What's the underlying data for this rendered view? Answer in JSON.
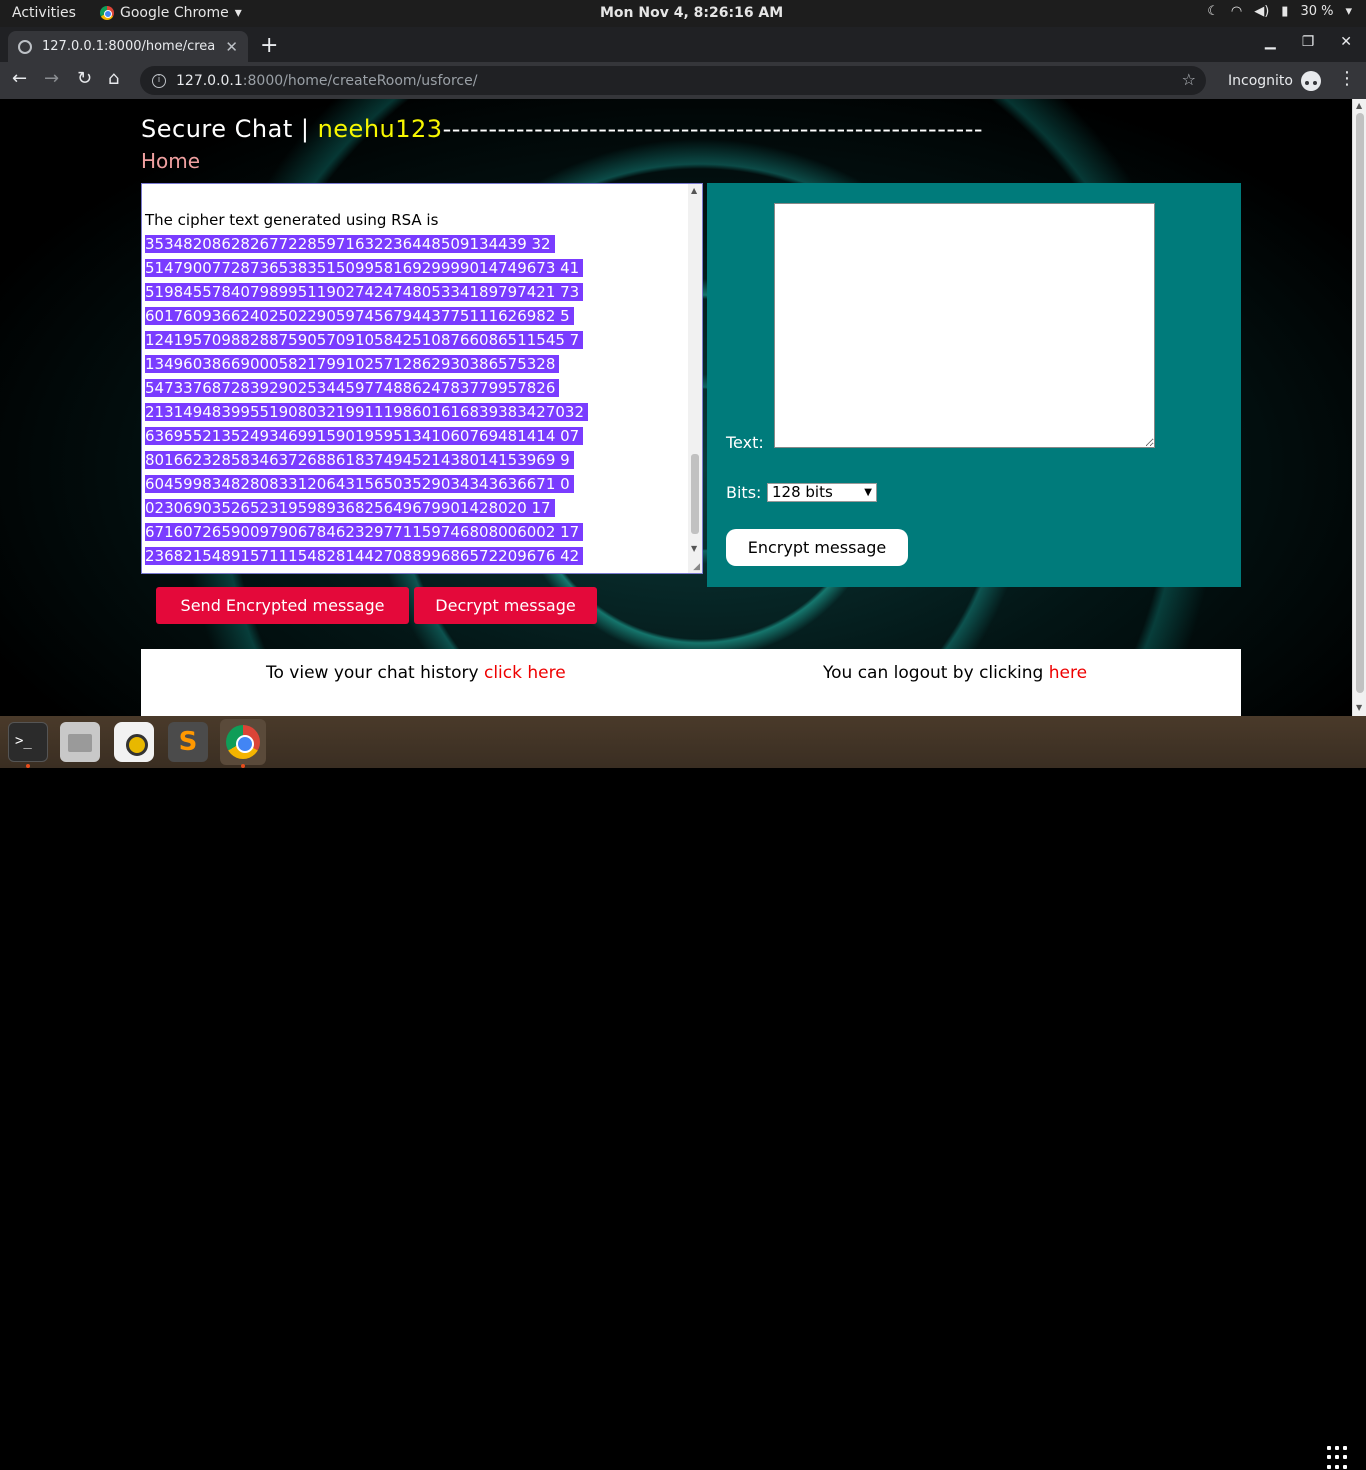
{
  "system": {
    "activities": "Activities",
    "app_menu": "Google Chrome",
    "clock": "Mon Nov  4,  8:26:16 AM",
    "battery": "30 %"
  },
  "browser": {
    "tab_title": "127.0.0.1:8000/home/crea",
    "url_host": "127.0.0.1",
    "url_path": ":8000/home/createRoom/usforce/",
    "incognito_label": "Incognito"
  },
  "page": {
    "brand": "Secure Chat | ",
    "username": "neehu123",
    "dashes": "-----------------------------------------------------------",
    "home_link": "Home",
    "cipher": {
      "intro": "The cipher text generated using RSA is",
      "lines": [
        "3534820862826772285971632236448509134439 32",
        "5147900772873653835150995816929999014749673 41",
        "5198455784079899511902742474805334189797421 73",
        "6017609366240250229059745679443775111626982 5",
        "12419570988288759057091058425108766086511545 7",
        "1349603866900058217991025712862930386575328",
        "5473376872839290253445977488624783779957826",
        "2131494839955190803219911198601616839383427032",
        "6369552135249346991590195951341060769481414 07",
        "8016623285834637268861837494521438014153969 9",
        "6045998348280833120643156503529034343636671 0",
        "0230690352652319598936825649679901428020 17",
        "6716072659009790678462329771159746808006002 17",
        "2368215489157111548281442708899686572209676 42"
      ]
    },
    "encrypt_panel": {
      "text_label": "Text:",
      "bits_label": "Bits:",
      "bits_value": "128 bits",
      "encrypt_button": "Encrypt message"
    },
    "send_button": "Send Encrypted message",
    "decrypt_button": "Decrypt message",
    "footer": {
      "history_text": "To view your chat history ",
      "history_link": "click here",
      "logout_text": "You can logout by clicking ",
      "logout_link": "here"
    }
  },
  "dock": {
    "terminal_glyph": ">_"
  }
}
